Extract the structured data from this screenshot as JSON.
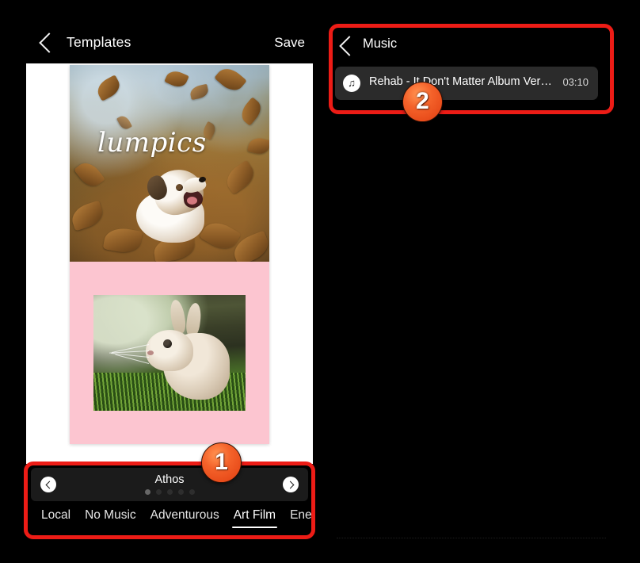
{
  "meta": {
    "accent_red": "#ed1c16",
    "badge_orange": "#f4622a",
    "pink_background": "#fcc5d0",
    "panel_background": "#000000"
  },
  "template_editor": {
    "back_icon": "chevron-left-icon",
    "title": "Templates",
    "save_label": "Save",
    "preview": {
      "watermark": "lumpics",
      "top_photo_alt": "dog barking among falling autumn leaves",
      "bottom_photo_alt": "beige rabbit sitting in green grass",
      "pink_panel_color": "#fcc5d0"
    },
    "carousel": {
      "prev_icon": "chevron-left-circle-icon",
      "next_icon": "chevron-right-circle-icon",
      "title": "Athos",
      "dot_count": 5,
      "active_dot_index": 0
    },
    "tabs": [
      {
        "label": "Local",
        "active": false
      },
      {
        "label": "No Music",
        "active": false
      },
      {
        "label": "Adventurous",
        "active": false
      },
      {
        "label": "Art Film",
        "active": true
      },
      {
        "label": "Energetic",
        "active": false
      }
    ]
  },
  "music_panel": {
    "back_icon": "chevron-left-icon",
    "title": "Music",
    "tracks": [
      {
        "icon": "music-note-icon",
        "name": "Rehab - It Don't Matter Album Versi...",
        "duration": "03:10",
        "selected": true
      }
    ]
  },
  "annotations": {
    "badges": [
      {
        "label": "1",
        "target": "template-music-bottom-bar"
      },
      {
        "label": "2",
        "target": "music-track-list"
      }
    ],
    "highlight_color": "#ed1c16"
  }
}
